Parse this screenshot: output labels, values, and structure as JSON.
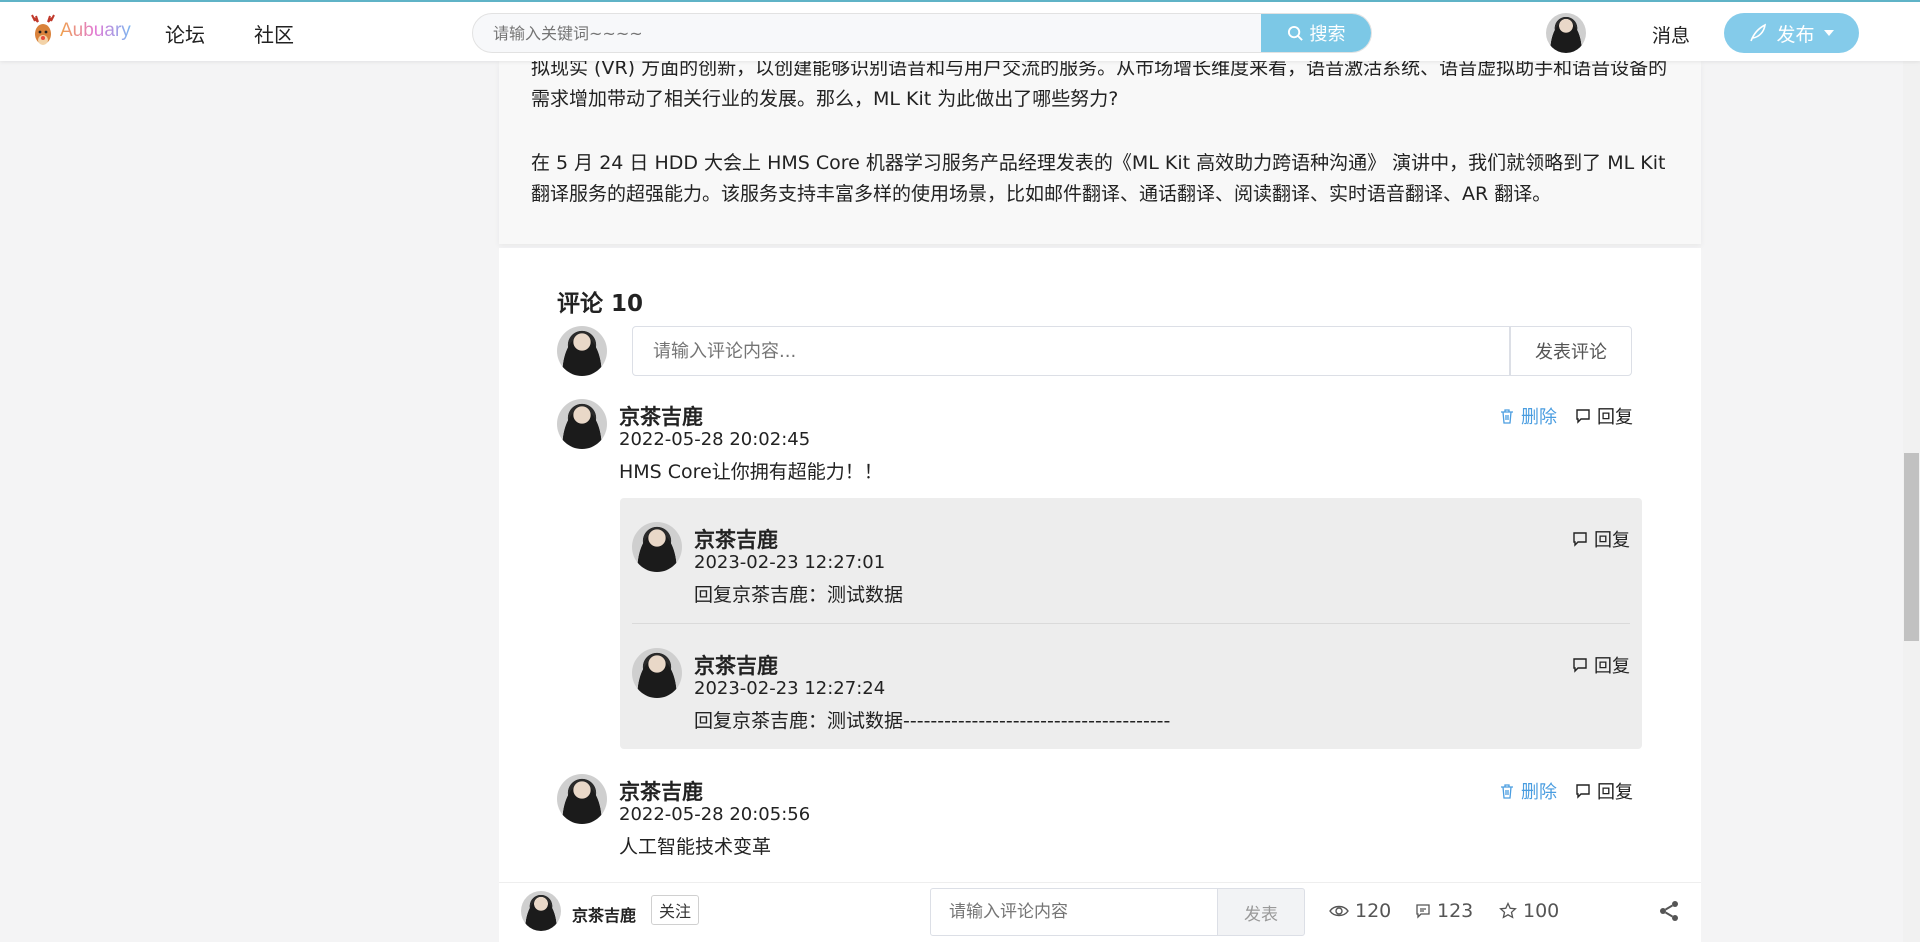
{
  "header": {
    "logo_text": "Aubuary",
    "nav": [
      "论坛",
      "社区"
    ],
    "search_placeholder": "请输入关键词~~~~",
    "search_button": "搜索",
    "messages": "消息",
    "publish": "发布"
  },
  "article": {
    "para1": "拟现实 (VR) 方面的创新，以创建能够识别语音和与用户交流的服务。从市场增长维度来看，语音激活系统、语音虚拟助手和语音设备的需求增加带动了相关行业的发展。那么，ML Kit 为此做出了哪些努力?",
    "para2": "在 5 月 24 日 HDD 大会上 HMS Core 机器学习服务产品经理发表的《ML Kit 高效助力跨语种沟通》 演讲中，我们就领略到了 ML Kit 翻译服务的超强能力。该服务支持丰富多样的使用场景，比如邮件翻译、通话翻译、阅读翻译、实时语音翻译、AR 翻译。"
  },
  "comments": {
    "title": "评论 10",
    "input_placeholder": "请输入评论内容...",
    "submit": "发表评论",
    "delete_label": "删除",
    "reply_label": "回复",
    "items": [
      {
        "name": "京茶吉鹿",
        "time": "2022-05-28 20:02:45",
        "text": "HMS Core让你拥有超能力！！",
        "replies": [
          {
            "name": "京茶吉鹿",
            "time": "2023-02-23 12:27:01",
            "text": "回复京茶吉鹿：测试数据"
          },
          {
            "name": "京茶吉鹿",
            "time": "2023-02-23 12:27:24",
            "text": "回复京茶吉鹿：测试数据---------------------------------------"
          }
        ]
      },
      {
        "name": "京茶吉鹿",
        "time": "2022-05-28 20:05:56",
        "text": "人工智能技术变革"
      }
    ]
  },
  "bottom_bar": {
    "author": "京茶吉鹿",
    "follow": "关注",
    "input_placeholder": "请输入评论内容",
    "send": "发表",
    "views": "120",
    "comments": "123",
    "stars": "100"
  },
  "colors": {
    "accent": "#7cc8e6",
    "delete": "#4a9de0"
  }
}
